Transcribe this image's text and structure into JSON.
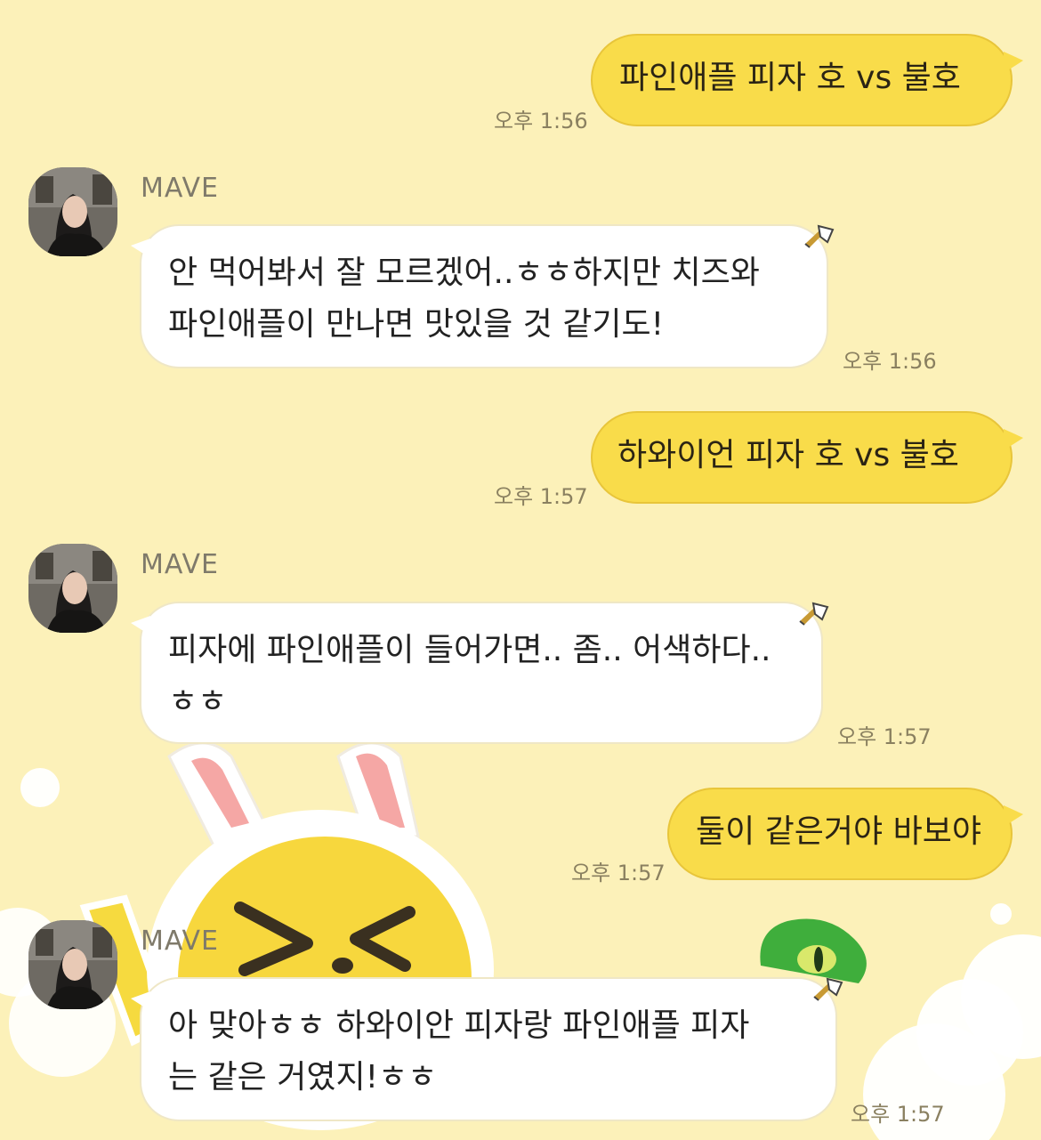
{
  "chat": {
    "messages": [
      {
        "type": "out",
        "text": "파인애플 피자 호 vs 불호",
        "time": "오후 1:56"
      },
      {
        "type": "in",
        "sender": "MAVE",
        "lines": [
          "안 먹어봐서 잘 모르겠어..ㅎㅎ하지만 치즈와",
          "파인애플이 만나면 맛있을 것 같기도!"
        ],
        "time": "오후 1:56"
      },
      {
        "type": "out",
        "text": "하와이언 피자 호 vs 불호",
        "time": "오후 1:57"
      },
      {
        "type": "in",
        "sender": "MAVE",
        "lines": [
          "피자에 파인애플이 들어가면.. 좀.. 어색하다..",
          "ㅎㅎ"
        ],
        "time": "오후 1:57"
      },
      {
        "type": "out",
        "text": "둘이 같은거야 바보야",
        "time": "오후 1:57"
      },
      {
        "type": "in",
        "sender": "MAVE",
        "lines": [
          "아 맞아ㅎㅎ 하와이안 피자랑 파인애플 피자",
          "는 같은 거였지!ㅎㅎ"
        ],
        "time": "오후 1:57"
      }
    ]
  },
  "colors": {
    "background": "#fcf1b9",
    "outgoing_bubble": "#f9dc4a",
    "incoming_bubble": "#ffffff",
    "time_text": "#8a8060"
  },
  "icons": {
    "avatar": "avatar-profile-icon",
    "reaction": "reaction-shortcut-icon"
  }
}
